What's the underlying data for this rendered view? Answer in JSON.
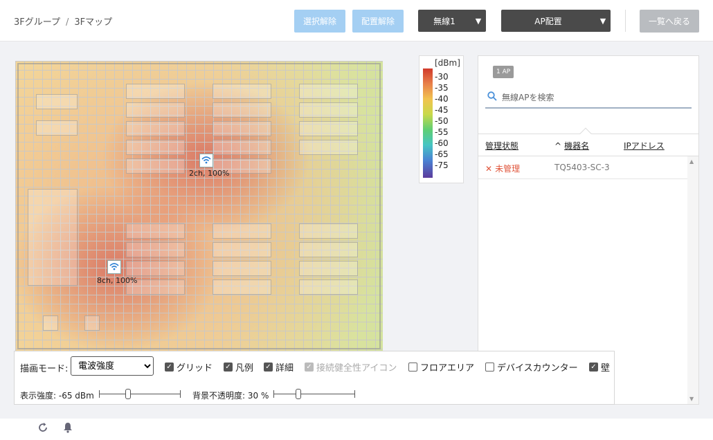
{
  "breadcrumb": {
    "group": "3Fグループ",
    "separator": "/",
    "map": "3Fマップ"
  },
  "toolbar": {
    "deselect_label": "選択解除",
    "unplace_label": "配置解除",
    "radio_dropdown_label": "無線1",
    "ap_place_dropdown_label": "AP配置",
    "back_label": "一覧へ戻る"
  },
  "map": {
    "aps": [
      {
        "label": "2ch, 100%"
      },
      {
        "label": "8ch, 100%"
      }
    ]
  },
  "legend": {
    "unit": "[dBm]",
    "ticks": [
      "-30",
      "-35",
      "-40",
      "-45",
      "-50",
      "-55",
      "-60",
      "-65",
      "-75"
    ]
  },
  "panel": {
    "ap_count": "1 AP",
    "search_placeholder": "無線APを検索",
    "columns": {
      "status": "管理状態",
      "sort_indicator": "^",
      "device": "機器名",
      "ip": "IPアドレス"
    },
    "rows": [
      {
        "status": "未管理",
        "device": "TQ5403-SC-3",
        "ip": ""
      }
    ]
  },
  "controls": {
    "mode_label": "描画モード:",
    "mode_value": "電波強度",
    "grid_label": "グリッド",
    "legend_label": "凡例",
    "detail_label": "詳細",
    "health_icon_label": "接続健全性アイコン",
    "floor_area_label": "フロアエリア",
    "device_counter_label": "デバイスカウンター",
    "wall_label": "壁",
    "strength_label": "表示強度: -65 dBm",
    "opacity_label": "背景不透明度: 30 %",
    "strength_value_dbm": -65,
    "opacity_percent": 30
  },
  "colors": {
    "accent": "#4a90d9",
    "unmanaged": "#e0553b",
    "dark_button": "#4a4a4a",
    "light_button": "#a4cff3"
  },
  "icons": {
    "refresh": "refresh-icon",
    "bell": "bell-icon",
    "search": "search-icon",
    "wifi": "wifi-icon"
  }
}
